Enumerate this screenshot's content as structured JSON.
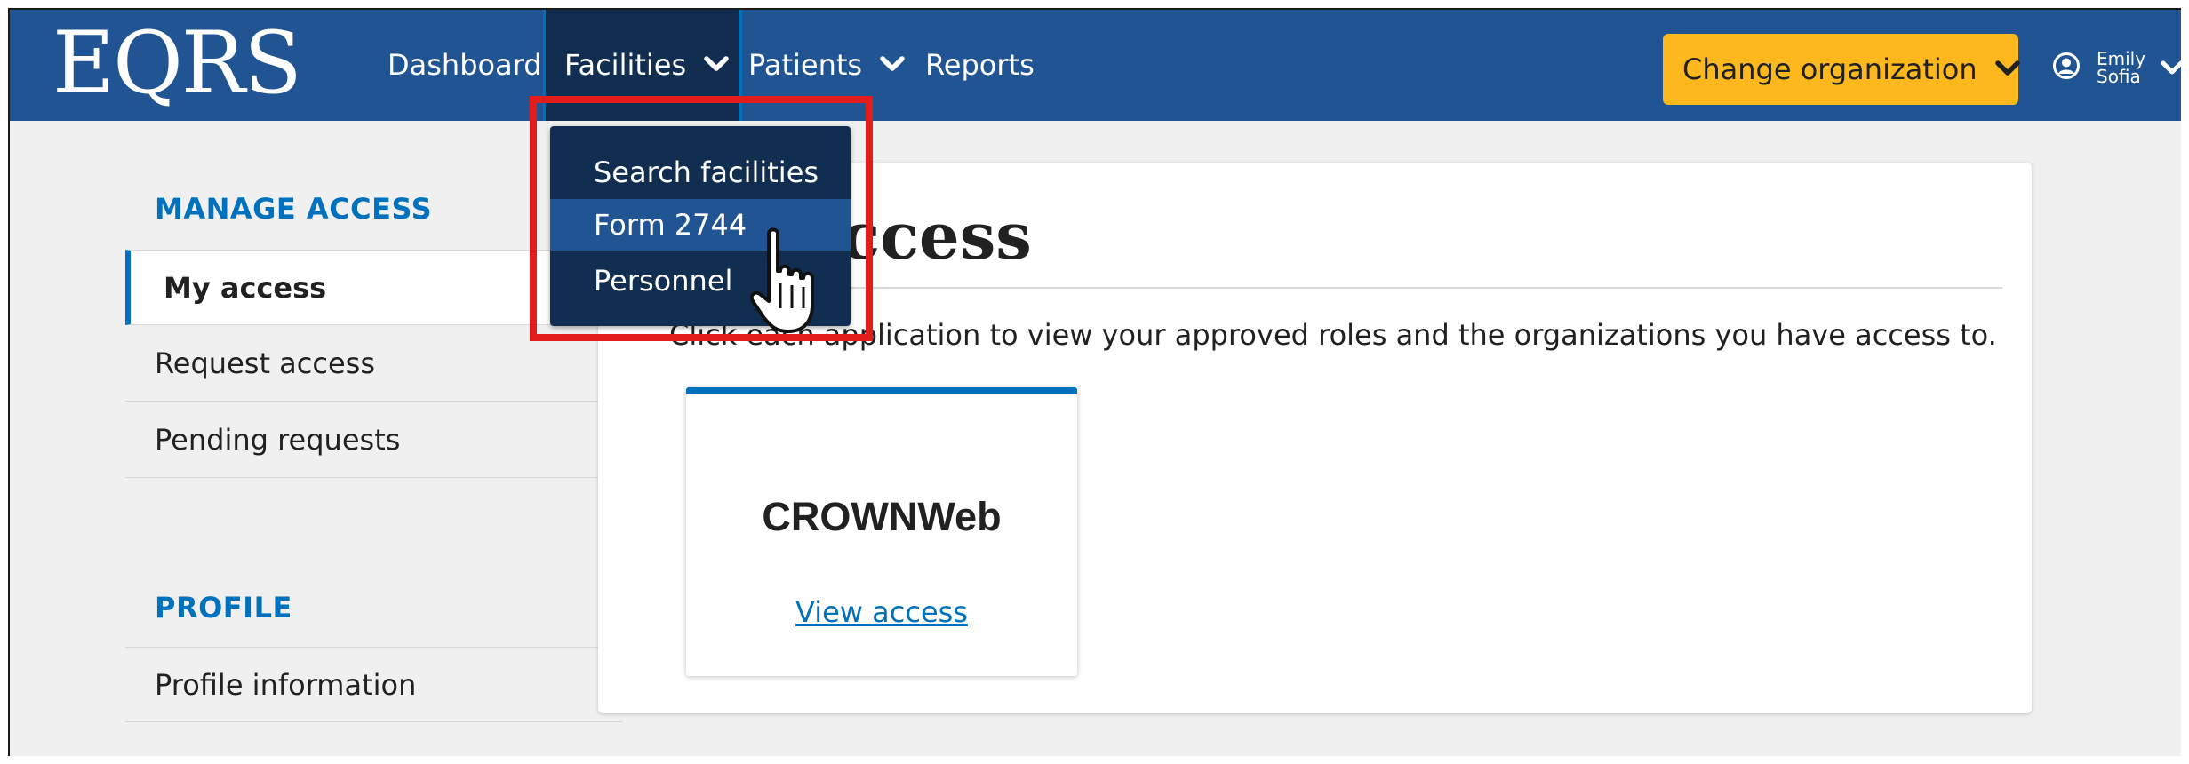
{
  "header": {
    "logo": "EQRS",
    "nav": {
      "dashboard": "Dashboard",
      "facilities": "Facilities",
      "patients": "Patients",
      "reports": "Reports"
    },
    "change_org": "Change organization",
    "user_first": "Emily",
    "user_last": "Sofia"
  },
  "dropdown": {
    "items": [
      "Search facilities",
      "Form 2744",
      "Personnel"
    ],
    "hovered": "Form 2744"
  },
  "sidebar": {
    "manage_access_heading": "MANAGE ACCESS",
    "items": [
      "My access",
      "Request access",
      "Pending requests"
    ],
    "active": "My access",
    "profile_heading": "PROFILE",
    "profile_items": [
      "Profile information"
    ]
  },
  "main": {
    "title": "My access",
    "description": "Click each application to view your approved roles and the organizations you have access to.",
    "application": {
      "name": "CROWNWeb",
      "link": "View access"
    }
  },
  "colors": {
    "header": "#205493",
    "dropdown": "#112e51",
    "accent": "#0071bc",
    "button": "#fdb81e",
    "highlight": "#e31c1c"
  }
}
